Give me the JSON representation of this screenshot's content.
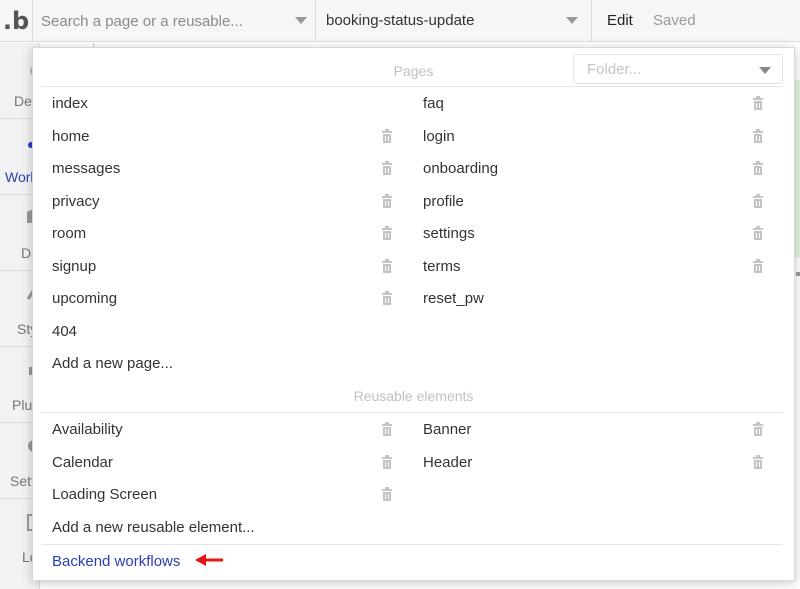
{
  "topbar": {
    "logo": ".b",
    "search_placeholder": "Search a page or a reusable...",
    "page_selected": "booking-status-update",
    "edit_label": "Edit",
    "saved_label": "Saved"
  },
  "sidebar": {
    "tabs": [
      {
        "label": "Design",
        "icon": "design-icon"
      },
      {
        "label": "Workflow",
        "icon": "workflow-icon"
      },
      {
        "label": "Data",
        "icon": "data-icon"
      },
      {
        "label": "Styles",
        "icon": "styles-icon"
      },
      {
        "label": "Plugins",
        "icon": "plugins-icon"
      },
      {
        "label": "Settings",
        "icon": "settings-icon"
      },
      {
        "label": "Logs",
        "icon": "logs-icon"
      }
    ]
  },
  "popup": {
    "folder_placeholder": "Folder...",
    "pages_title": "Pages",
    "pages": [
      {
        "name": "index"
      },
      {
        "name": "faq"
      },
      {
        "name": "home"
      },
      {
        "name": "login"
      },
      {
        "name": "messages"
      },
      {
        "name": "onboarding"
      },
      {
        "name": "privacy"
      },
      {
        "name": "profile"
      },
      {
        "name": "room"
      },
      {
        "name": "settings"
      },
      {
        "name": "signup"
      },
      {
        "name": "terms"
      },
      {
        "name": "upcoming"
      },
      {
        "name": "reset_pw"
      },
      {
        "name": "404"
      }
    ],
    "add_page": "Add a new page...",
    "reusable_title": "Reusable elements",
    "reusables": [
      {
        "name": "Availability"
      },
      {
        "name": "Banner"
      },
      {
        "name": "Calendar"
      },
      {
        "name": "Header"
      },
      {
        "name": "Loading Screen"
      }
    ],
    "add_reusable": "Add a new reusable element...",
    "backend_workflows": "Backend workflows"
  },
  "colors": {
    "link": "#2a3db5",
    "arrow": "#e8141a",
    "trash": "#c4c4c4"
  }
}
